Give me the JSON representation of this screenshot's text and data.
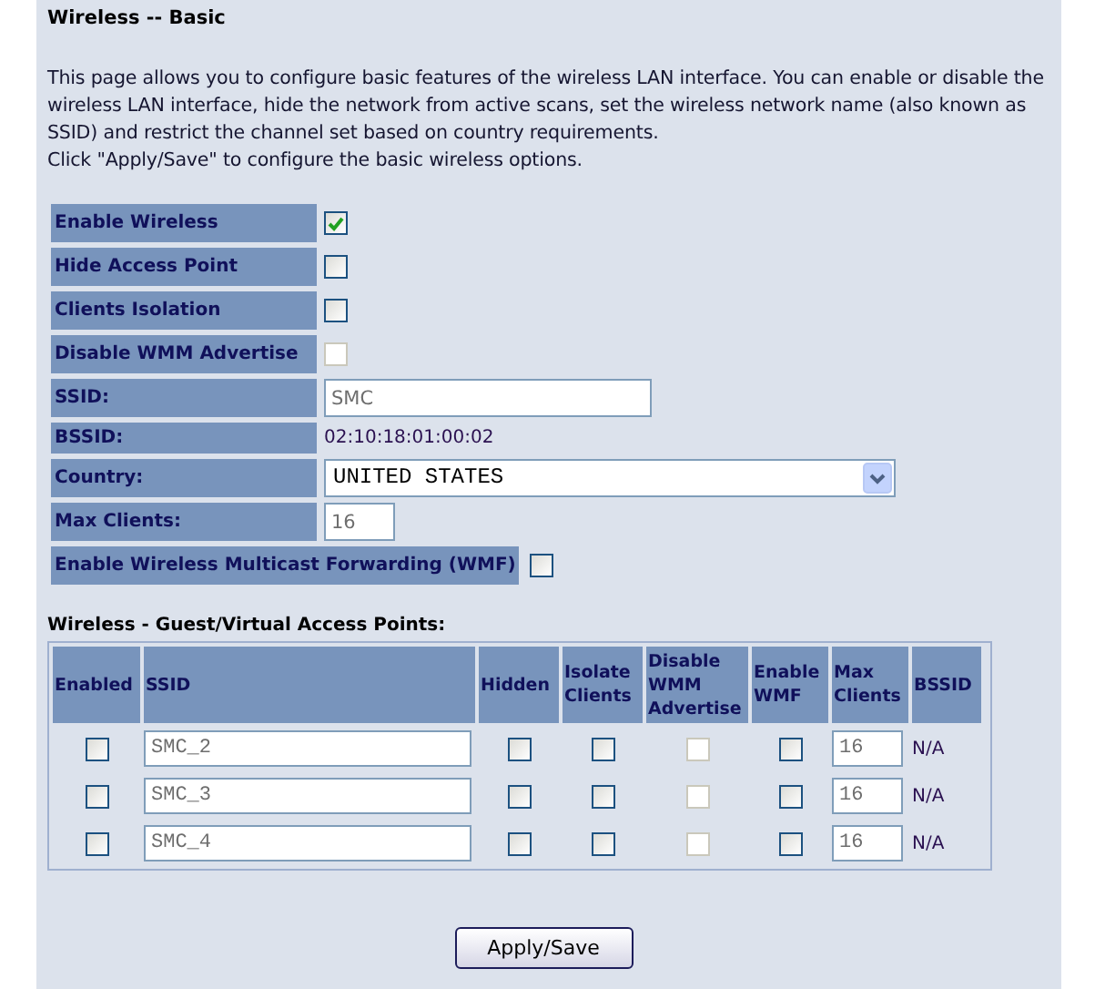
{
  "page": {
    "title": "Wireless -- Basic",
    "description": [
      "This page allows you to configure basic features of the wireless LAN interface. You can enable or disable the wireless LAN interface, hide the network from active scans, set the wireless network name (also known as SSID) and restrict the channel set based on country requirements.",
      "Click \"Apply/Save\" to configure the basic wireless options."
    ]
  },
  "settings": [
    {
      "kind": "checkbox",
      "label": "Enable Wireless",
      "checked": true,
      "disabled": false
    },
    {
      "kind": "checkbox",
      "label": "Hide Access Point",
      "checked": false,
      "disabled": false
    },
    {
      "kind": "checkbox",
      "label": "Clients Isolation",
      "checked": false,
      "disabled": false
    },
    {
      "kind": "checkbox",
      "label": "Disable WMM Advertise",
      "checked": false,
      "disabled": true
    },
    {
      "kind": "input",
      "label": "SSID:",
      "value": "SMC"
    },
    {
      "kind": "text",
      "label": "BSSID:",
      "value": "02:10:18:01:00:02"
    },
    {
      "kind": "select",
      "label": "Country:",
      "value": "UNITED STATES"
    },
    {
      "kind": "short_input",
      "label": "Max Clients:",
      "value": "16"
    },
    {
      "kind": "wide_checkbox",
      "label": "Enable Wireless Multicast Forwarding (WMF)",
      "checked": false,
      "disabled": false
    }
  ],
  "guest": {
    "title": "Wireless - Guest/Virtual Access Points:",
    "columns": [
      "Enabled",
      "SSID",
      "Hidden",
      "Isolate Clients",
      "Disable WMM Advertise",
      "Enable WMF",
      "Max Clients",
      "BSSID"
    ],
    "rows": [
      {
        "enabled": false,
        "ssid": "SMC_2",
        "hidden": false,
        "isolate": false,
        "wmm": {
          "checked": false,
          "disabled": true
        },
        "wmf": false,
        "max_clients": "16",
        "bssid": "N/A"
      },
      {
        "enabled": false,
        "ssid": "SMC_3",
        "hidden": false,
        "isolate": false,
        "wmm": {
          "checked": false,
          "disabled": true
        },
        "wmf": false,
        "max_clients": "16",
        "bssid": "N/A"
      },
      {
        "enabled": false,
        "ssid": "SMC_4",
        "hidden": false,
        "isolate": false,
        "wmm": {
          "checked": false,
          "disabled": true
        },
        "wmf": false,
        "max_clients": "16",
        "bssid": "N/A"
      }
    ]
  },
  "apply_button": "Apply/Save"
}
